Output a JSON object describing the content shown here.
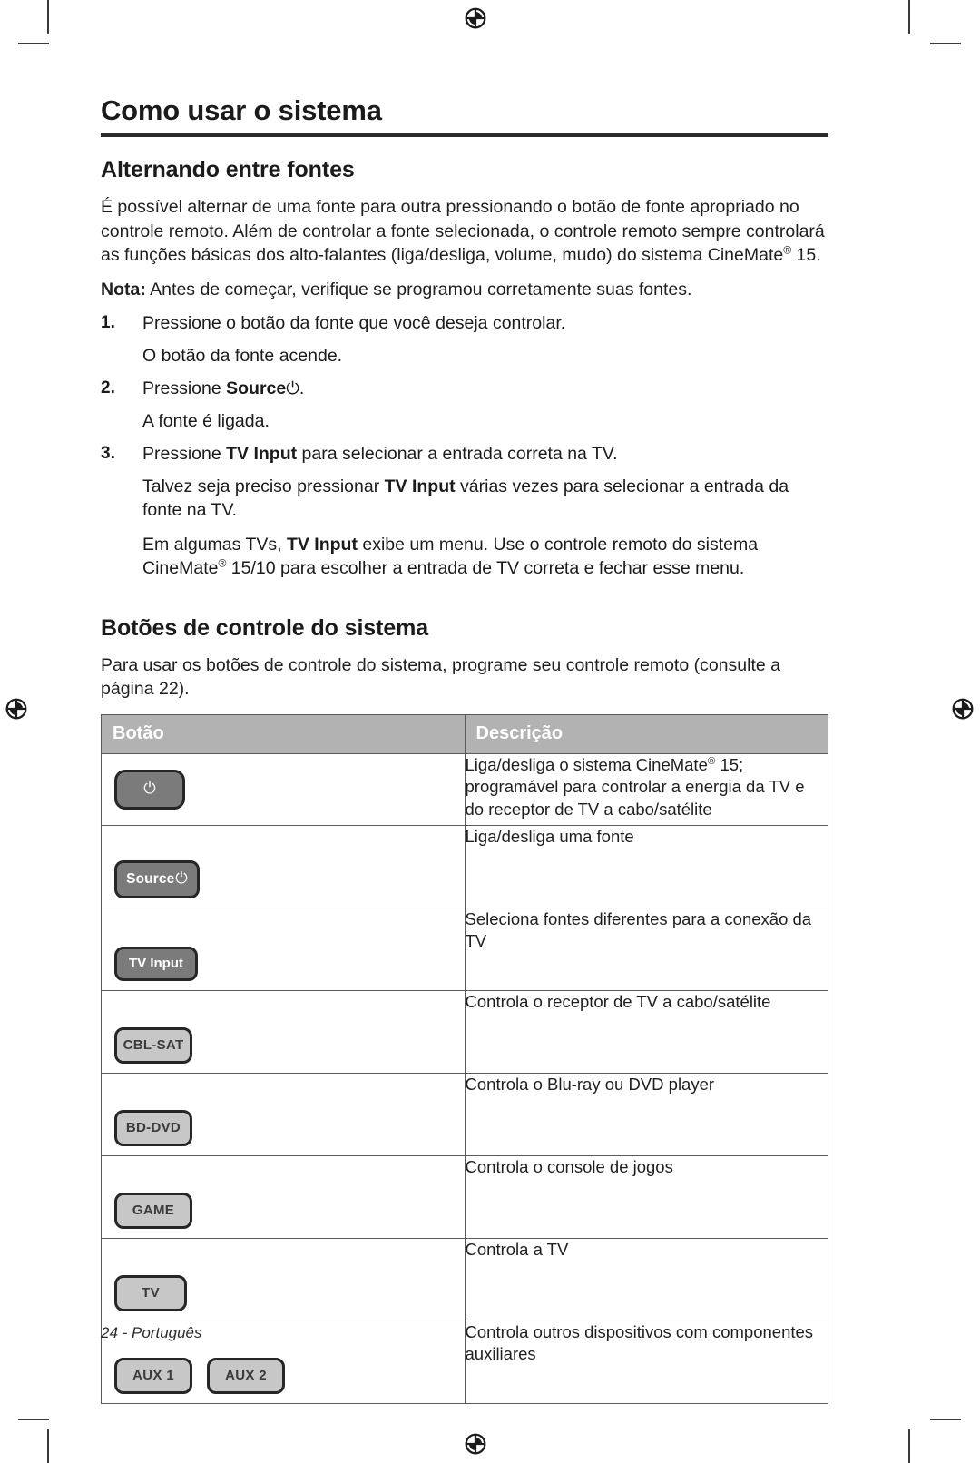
{
  "page_title": "Como usar o sistema",
  "sections": [
    {
      "heading": "Alternando entre fontes",
      "intro_parts": {
        "p1_a": "É possível alternar de uma fonte para outra pressionando o botão de fonte apropriado no controle remoto. Além de controlar a fonte selecionada, o controle remoto sempre controlará as funções básicas dos alto-falantes (liga/desliga, volume, mudo) do sistema CineMate",
        "p1_sup": "®",
        "p1_b": " 15."
      },
      "note_label": "Nota:",
      "note_text": " Antes de começar, verifique se programou corretamente suas fontes.",
      "steps": [
        {
          "num": "1.",
          "text": "Pressione o botão da fonte que você deseja controlar.",
          "sub": "O botão da fonte acende."
        },
        {
          "num": "2.",
          "text_a": "Pressione ",
          "text_bold": "Source",
          "text_glyph": "⏻",
          "text_b": ".",
          "sub": "A fonte é ligada."
        },
        {
          "num": "3.",
          "text_a": "Pressione ",
          "text_bold": "TV Input",
          "text_b": " para selecionar a entrada correta na TV.",
          "para2_a": "Talvez seja preciso pressionar ",
          "para2_bold": "TV Input",
          "para2_b": " várias vezes para selecionar a entrada da fonte na TV.",
          "para3_a": "Em algumas TVs, ",
          "para3_bold": "TV Input",
          "para3_b": " exibe um menu. Use o controle remoto do sistema CineMate",
          "para3_sup": "®",
          "para3_c": " 15/10 para escolher a entrada de TV correta e fechar esse menu."
        }
      ]
    },
    {
      "heading": "Botões de controle do sistema",
      "intro": "Para usar os botões de controle do sistema, programe seu controle remoto (consulte a página 22)."
    }
  ],
  "table": {
    "headers": [
      "Botão",
      "Descrição"
    ],
    "rows": [
      {
        "keys": [
          {
            "label": "",
            "glyph": "⏻",
            "style": "dark",
            "shape": "power"
          }
        ],
        "desc_a": "Liga/desliga o sistema CineMate",
        "desc_sup": "®",
        "desc_b": " 15; programável para controlar a energia da TV e do receptor de TV a cabo/satélite"
      },
      {
        "keys": [
          {
            "label": "Source",
            "glyph": "⏻",
            "style": "dark",
            "shape": "source"
          }
        ],
        "desc_a": "Liga/desliga uma fonte",
        "desc_sup": "",
        "desc_b": ""
      },
      {
        "keys": [
          {
            "label": "TV Input",
            "glyph": "",
            "style": "dark",
            "shape": "tvinput"
          }
        ],
        "desc_a": "Seleciona fontes diferentes para a conexão da TV",
        "desc_sup": "",
        "desc_b": ""
      },
      {
        "keys": [
          {
            "label": "CBL-SAT",
            "glyph": "",
            "style": "light",
            "shape": "label"
          }
        ],
        "desc_a": "Controla o receptor de TV a cabo/satélite",
        "desc_sup": "",
        "desc_b": ""
      },
      {
        "keys": [
          {
            "label": "BD-DVD",
            "glyph": "",
            "style": "light",
            "shape": "label"
          }
        ],
        "desc_a": "Controla o Blu-ray ou DVD player",
        "desc_sup": "",
        "desc_b": ""
      },
      {
        "keys": [
          {
            "label": "GAME",
            "glyph": "",
            "style": "light",
            "shape": "label"
          }
        ],
        "desc_a": "Controla o console de jogos",
        "desc_sup": "",
        "desc_b": ""
      },
      {
        "keys": [
          {
            "label": "TV",
            "glyph": "",
            "style": "light",
            "shape": "label tvkey"
          }
        ],
        "desc_a": "Controla a TV",
        "desc_sup": "",
        "desc_b": ""
      },
      {
        "keys": [
          {
            "label": "AUX 1",
            "glyph": "",
            "style": "light",
            "shape": "label"
          },
          {
            "label": "AUX 2",
            "glyph": "",
            "style": "light",
            "shape": "label"
          }
        ],
        "desc_a": "Controla outros dispositivos com componentes auxiliares",
        "desc_sup": "",
        "desc_b": ""
      }
    ]
  },
  "footer": "24 - Português",
  "colors": {
    "table_header_bg": "#b2b2b2",
    "key_dark": "#7b7b7b",
    "key_light": "#c7c7c7",
    "rule": "#2b2b2b"
  }
}
